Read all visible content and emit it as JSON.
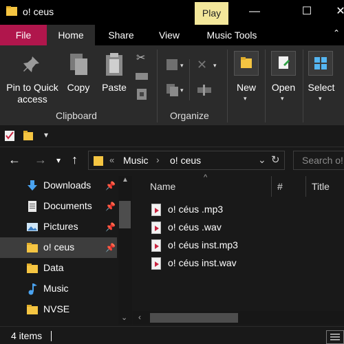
{
  "window": {
    "title": "o! ceus",
    "contextual_tab": "Play",
    "minimize_glyph": "—",
    "maximize_glyph": "☐",
    "close_glyph": "✕"
  },
  "ribbon_tabs": [
    "File",
    "Home",
    "Share",
    "View",
    "Music Tools"
  ],
  "clipboard": {
    "pin_label_line1": "Pin to Quick",
    "pin_label_line2": "access",
    "copy_label": "Copy",
    "paste_label": "Paste",
    "group_label": "Clipboard"
  },
  "organize": {
    "group_label": "Organize"
  },
  "big_buttons": {
    "new_label": "New",
    "open_label": "Open",
    "select_label": "Select"
  },
  "address": {
    "chevrons": "«",
    "crumb_1": "Music",
    "separator": "›",
    "crumb_2": "o! ceus",
    "search_placeholder": "Search o!"
  },
  "nav_pane": {
    "items": [
      {
        "label": "Downloads",
        "icon": "download-arrow-icon",
        "pinned": true
      },
      {
        "label": "Documents",
        "icon": "document-icon",
        "pinned": true
      },
      {
        "label": "Pictures",
        "icon": "pictures-icon",
        "pinned": true
      },
      {
        "label": "o! ceus",
        "icon": "folder-icon",
        "pinned": true,
        "selected": true
      },
      {
        "label": "Data",
        "icon": "folder-icon"
      },
      {
        "label": "Music",
        "icon": "music-note-icon"
      },
      {
        "label": "NVSE",
        "icon": "folder-icon"
      }
    ]
  },
  "columns": {
    "name": "Name",
    "number": "#",
    "title": "Title"
  },
  "files": [
    {
      "name": "o! céus .mp3"
    },
    {
      "name": "o! céus .wav"
    },
    {
      "name": "o! céus inst.mp3"
    },
    {
      "name": "o! céus inst.wav"
    }
  ],
  "status": {
    "item_count": "4 items"
  },
  "colors": {
    "accent_file_tab": "#b0164c",
    "play_tab": "#f3e79a",
    "folder": "#f5c542",
    "selected_row": "#3d3d3d"
  }
}
